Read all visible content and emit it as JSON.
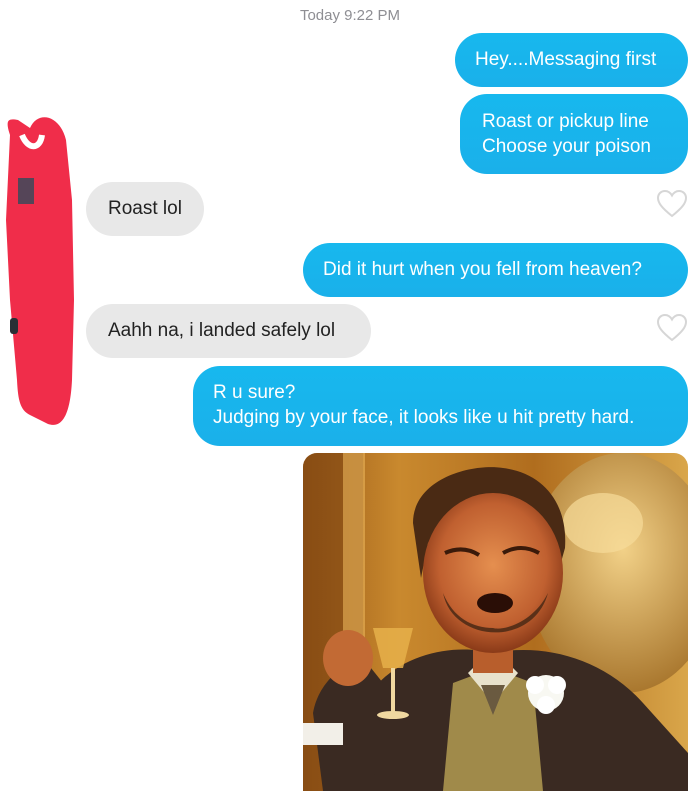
{
  "header": {
    "timestamp": "Today 9:22 PM"
  },
  "messages": [
    {
      "direction": "sent",
      "lines": [
        "Hey....Messaging first"
      ]
    },
    {
      "direction": "sent",
      "lines": [
        "Roast or pickup line",
        "Choose your poison"
      ]
    },
    {
      "direction": "received",
      "lines": [
        "Roast lol"
      ],
      "like_icon": "heart-outline-icon"
    },
    {
      "direction": "sent",
      "lines": [
        "Did it hurt when you fell from heaven?"
      ]
    },
    {
      "direction": "received",
      "lines": [
        "Aahh na, i landed safely lol"
      ],
      "like_icon": "heart-outline-icon"
    },
    {
      "direction": "sent",
      "lines": [
        "R u sure?",
        "Judging by your face, it looks like u hit pretty hard."
      ]
    },
    {
      "direction": "sent",
      "type": "image",
      "content": "laughing-man-holding-glass-meme"
    }
  ],
  "colors": {
    "sent_bubble": "#1ab7ea",
    "received_bubble": "#e8e8e8",
    "redaction_mark": "#f02d4a",
    "timestamp_text": "#8e8e93"
  }
}
